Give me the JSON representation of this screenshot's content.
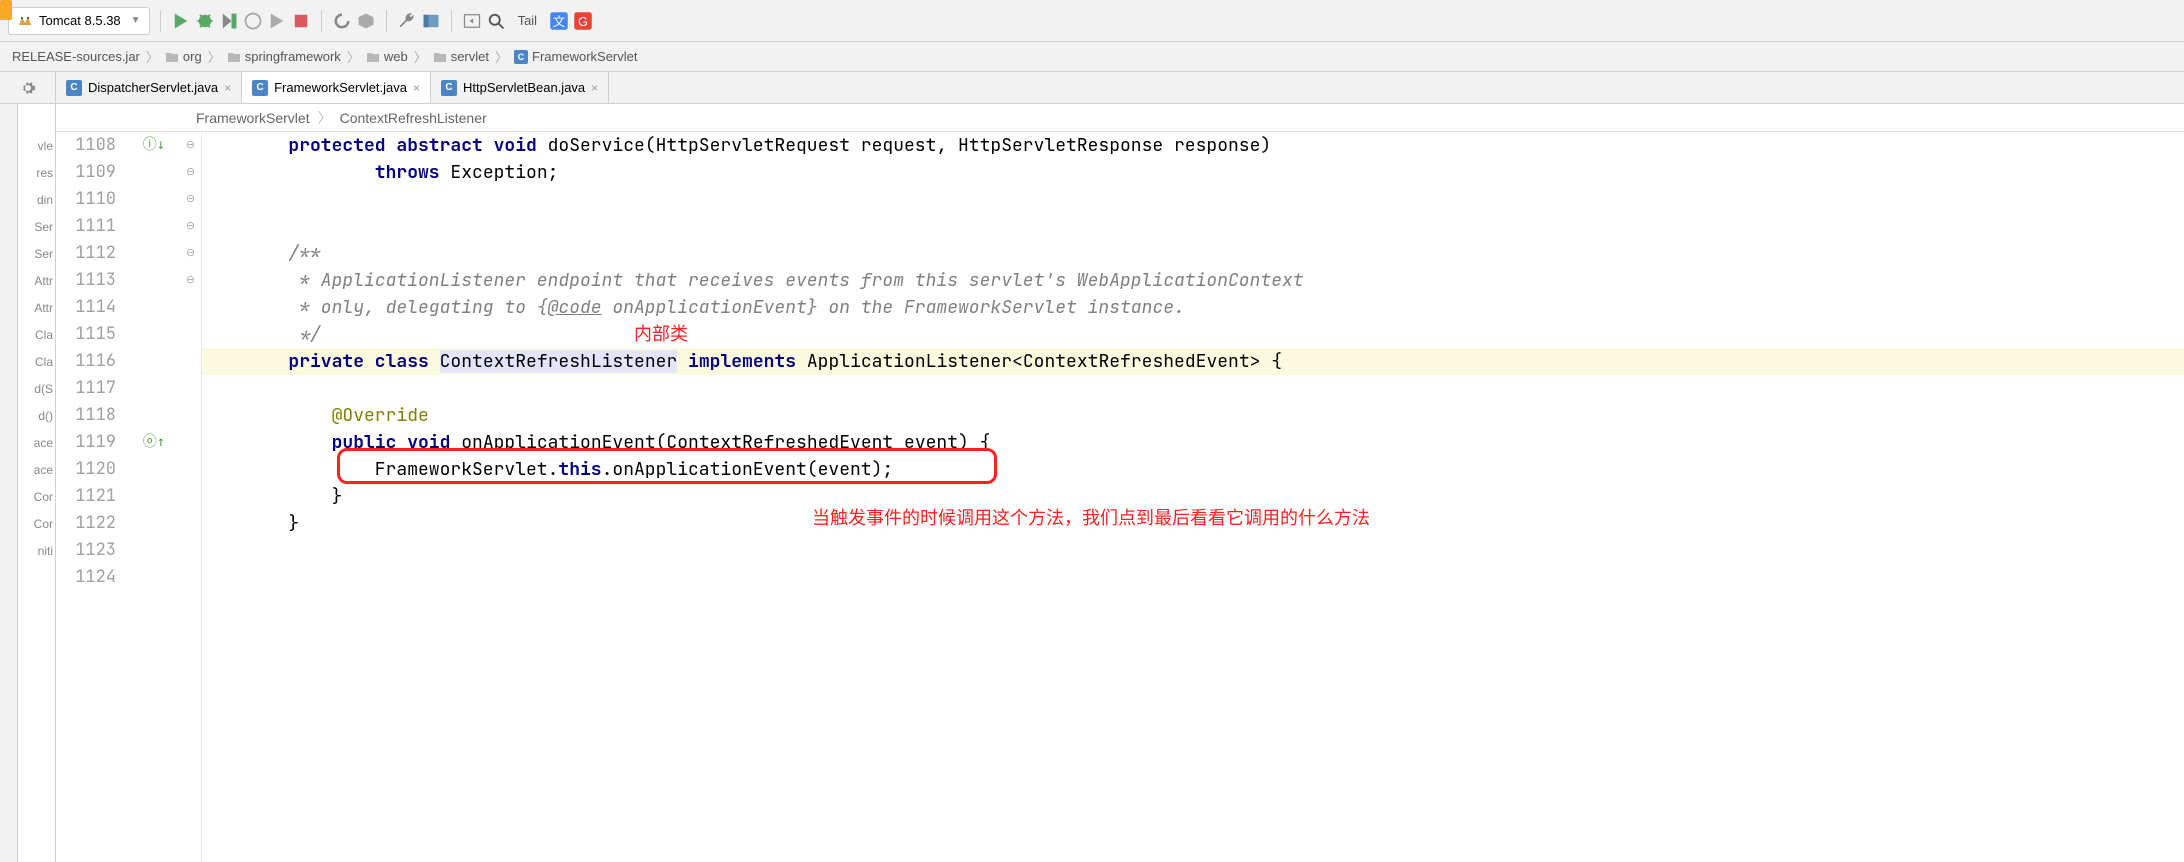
{
  "toolbar": {
    "run_config": "Tomcat 8.5.38",
    "tail_label": "Tail"
  },
  "breadcrumb": {
    "jar": "RELEASE-sources.jar",
    "pkg1": "org",
    "pkg2": "springframework",
    "pkg3": "web",
    "pkg4": "servlet",
    "class": "FrameworkServlet"
  },
  "tabs": [
    {
      "label": "DispatcherServlet.java",
      "active": false
    },
    {
      "label": "FrameworkServlet.java",
      "active": true
    },
    {
      "label": "HttpServletBean.java",
      "active": false
    }
  ],
  "code_breadcrumb": {
    "class": "FrameworkServlet",
    "member": "ContextRefreshListener"
  },
  "outline_items": [
    "vle",
    "res",
    "din",
    "Ser",
    "Ser",
    "Attr",
    "Attr",
    "Cla",
    "Cla",
    "d(S",
    "d()",
    "ace",
    "ace",
    "Cor",
    "Cor",
    "niti"
  ],
  "lines": [
    {
      "n": 1108,
      "marker": "impl",
      "fold": "",
      "html": "        <span class=\"kw\">protected abstract void</span> doService(HttpServletRequest request, HttpServletResponse response)"
    },
    {
      "n": 1109,
      "marker": "",
      "fold": "",
      "html": "                <span class=\"kw\">throws</span> Exception;"
    },
    {
      "n": 1110,
      "marker": "",
      "fold": "",
      "html": ""
    },
    {
      "n": 1111,
      "marker": "",
      "fold": "",
      "html": ""
    },
    {
      "n": 1112,
      "marker": "",
      "fold": "⊖",
      "html": "        <span class=\"comment\">/**</span>"
    },
    {
      "n": 1113,
      "marker": "",
      "fold": "",
      "html": "<span class=\"comment\">         * ApplicationListener endpoint that receives events from this servlet's WebApplicationContext</span>"
    },
    {
      "n": 1114,
      "marker": "",
      "fold": "",
      "html": "<span class=\"comment\">         * only, delegating to {<u>@code</u> onApplicationEvent} on the FrameworkServlet instance.</span>"
    },
    {
      "n": 1115,
      "marker": "",
      "fold": "⊖",
      "html": "<span class=\"comment\">         */</span>"
    },
    {
      "n": 1116,
      "marker": "",
      "fold": "⊖",
      "hl": true,
      "html": "        <span class=\"kw\">private class</span> <span class=\"class-hl\">ContextRefreshListener</span> <span class=\"kw\">implements</span> ApplicationListener&lt;ContextRefreshedEvent&gt; {"
    },
    {
      "n": 1117,
      "marker": "",
      "fold": "",
      "html": ""
    },
    {
      "n": 1118,
      "marker": "",
      "fold": "",
      "html": "            <span class=\"annot\">@Override</span>"
    },
    {
      "n": 1119,
      "marker": "over",
      "fold": "⊖",
      "html": "            <span class=\"kw\">public void</span> onApplicationEvent(ContextRefreshedEvent event) {"
    },
    {
      "n": 1120,
      "marker": "",
      "fold": "",
      "html": "                FrameworkServlet.<span class=\"kw\">this</span>.onApplicationEvent(event);"
    },
    {
      "n": 1121,
      "marker": "",
      "fold": "⊖",
      "html": "            }"
    },
    {
      "n": 1122,
      "marker": "",
      "fold": "⊖",
      "html": "        }"
    },
    {
      "n": 1123,
      "marker": "",
      "fold": "",
      "html": ""
    },
    {
      "n": 1124,
      "marker": "",
      "fold": "",
      "html": ""
    }
  ],
  "annotations": {
    "inner_class": "内部类",
    "trigger_comment": "当触发事件的时候调用这个方法，我们点到最后看看它调用的什么方法"
  }
}
